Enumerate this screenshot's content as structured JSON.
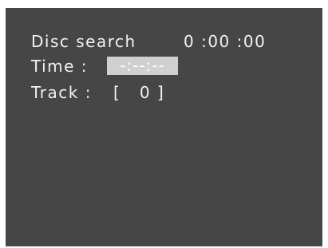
{
  "screen": {
    "title": "Disc search",
    "counter": "0 :00 :00",
    "time_label": "Time :",
    "time_value": "-:--:--",
    "track_label": "Track :",
    "track_value": "[   0 ]"
  },
  "colors": {
    "background": "#464646",
    "text": "#f2f2f2",
    "input_highlight": "#d0d0d0"
  }
}
